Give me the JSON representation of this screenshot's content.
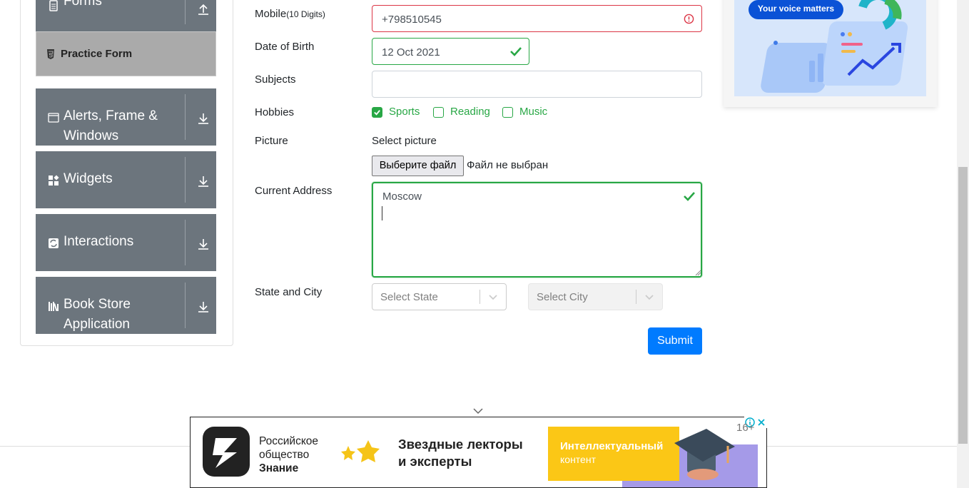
{
  "sidebar": {
    "forms_group": {
      "label": "Forms",
      "icon": "form-icon",
      "arrow": "arrow-up-icon"
    },
    "practice_form": {
      "label": "Practice Form",
      "icon": "html5-icon"
    },
    "groups": [
      {
        "label_line1": "Alerts, Frame &",
        "label_line2": "Windows",
        "icon": "browser-window-icon",
        "arrow": "arrow-down-icon"
      },
      {
        "label": "Widgets",
        "icon": "widgets-icon",
        "arrow": "arrow-down-icon"
      },
      {
        "label": "Interactions",
        "icon": "interactions-icon",
        "arrow": "arrow-down-icon"
      },
      {
        "label_line1": "Book Store",
        "label_line2": "Application",
        "icon": "books-icon",
        "arrow": "arrow-down-icon"
      }
    ]
  },
  "form": {
    "mobile": {
      "label": "Mobile",
      "hint": "(10 Digits)",
      "value": "+798510545",
      "state": "invalid"
    },
    "dob": {
      "label": "Date of Birth",
      "value": "12 Oct 2021",
      "state": "valid"
    },
    "subjects": {
      "label": "Subjects",
      "value": ""
    },
    "hobbies": {
      "label": "Hobbies",
      "options": [
        {
          "label": "Sports",
          "checked": true
        },
        {
          "label": "Reading",
          "checked": false
        },
        {
          "label": "Music",
          "checked": false
        }
      ]
    },
    "picture": {
      "label": "Picture",
      "hint": "Select picture",
      "button": "Выберите файл",
      "status": "Файл не выбран"
    },
    "address": {
      "label": "Current Address",
      "value": "Moscow",
      "state": "valid"
    },
    "state_city": {
      "label": "State and City",
      "state_placeholder": "Select State",
      "city_placeholder": "Select City"
    },
    "submit": "Submit"
  },
  "top_ad": {
    "pill": "Your voice matters"
  },
  "bottom_ad": {
    "org_line1": "Российское",
    "org_line2": "общество",
    "org_line3": "Знание",
    "headline_line1": "Звездные лекторы",
    "headline_line2": "и эксперты",
    "cta_line1": "Интеллектуальный",
    "cta_line2": "контент",
    "age": "16+"
  },
  "colors": {
    "valid": "#28a745",
    "invalid": "#dc3545",
    "primary": "#007bff",
    "sidebar": "#6c757d"
  }
}
